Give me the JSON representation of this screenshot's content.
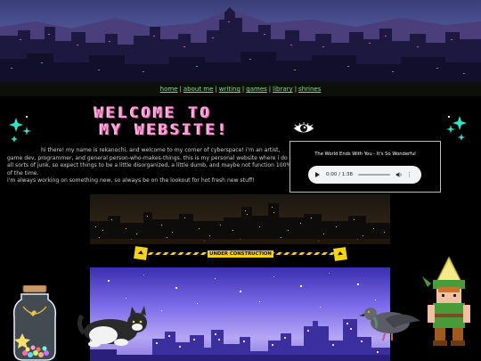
{
  "nav": {
    "items": [
      {
        "label": "home"
      },
      {
        "label": "about me"
      },
      {
        "label": "writing"
      },
      {
        "label": "games"
      },
      {
        "label": "library"
      },
      {
        "label": "shrines"
      }
    ],
    "separator": "|"
  },
  "hero": {
    "title_line1": "Welcome to",
    "title_line2": "my website!"
  },
  "intro": {
    "paragraph1": "hi there! my name is rekanochi, and welcome to my corner of cyberspace! i'm an artist, game dev, programmer, and general person-who-makes-things. this is my personal website where i do all sorts of junk, so expect things to be a little disorganized, a little dumb, and maybe not function 100% of the time.",
    "paragraph2": "i'm always working on something new, so always be on the lookout for hot fresh new stuff!"
  },
  "music_player": {
    "song_title": "The World Ends With You - It's So Wonderful",
    "time": "0:00 / 1:38",
    "progress": 0
  },
  "construction_banner": {
    "label": "UNDER CONSTRUCTION"
  },
  "colors": {
    "nav_link": "#7fe08a",
    "title_pink": "#ff9ad4",
    "star_teal": "#2ee6c8",
    "construction_yellow": "#f3d21a"
  }
}
